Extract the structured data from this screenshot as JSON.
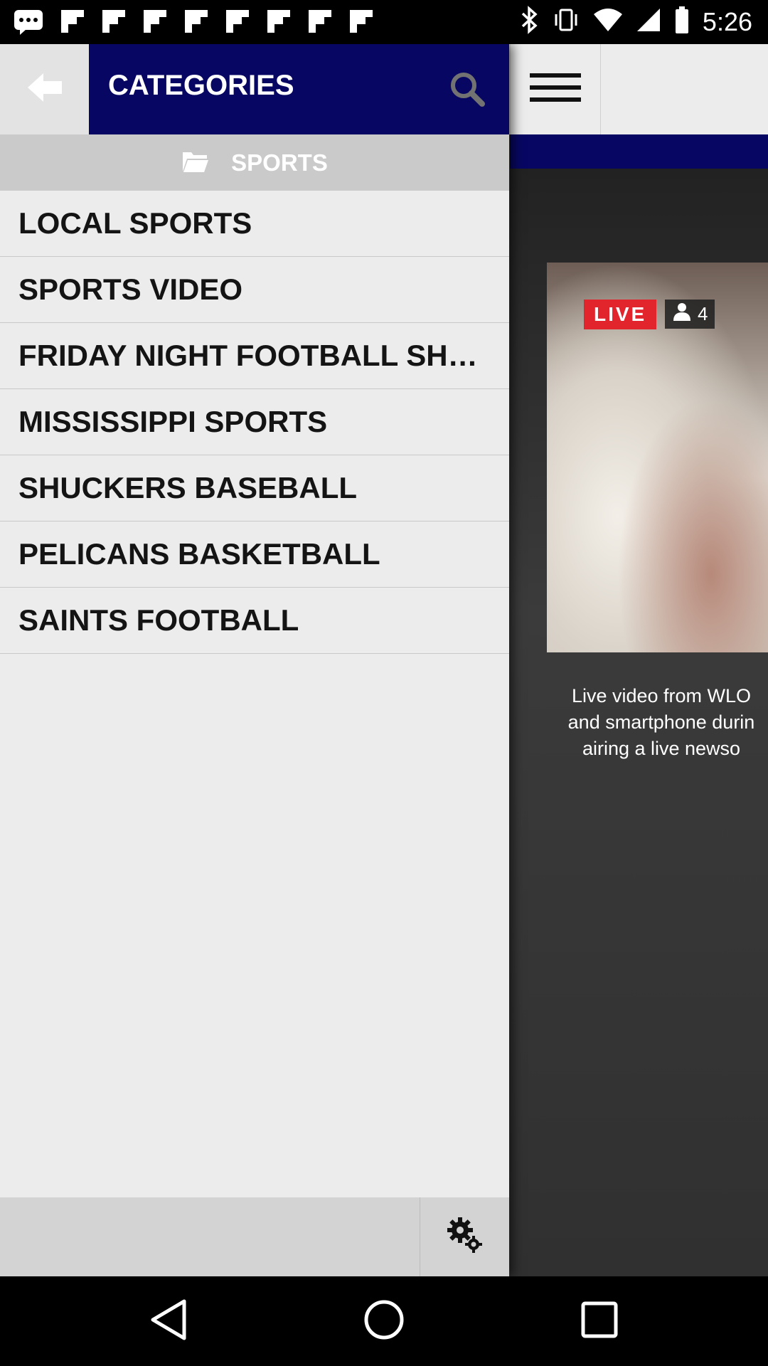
{
  "status_bar": {
    "time": "5:26",
    "icons": [
      "messages-icon",
      "flipboard-icon",
      "bluetooth-icon",
      "vibrate-icon",
      "wifi-icon",
      "signal-icon",
      "battery-icon"
    ]
  },
  "drawer": {
    "title": "CATEGORIES",
    "back_icon": "back-arrow-icon",
    "search_icon": "search-icon",
    "subheader": {
      "icon": "folder-icon",
      "label": "SPORTS"
    },
    "items": [
      {
        "label": "LOCAL SPORTS"
      },
      {
        "label": "SPORTS VIDEO"
      },
      {
        "label": "FRIDAY NIGHT FOOTBALL SHOWCASE"
      },
      {
        "label": "MISSISSIPPI SPORTS"
      },
      {
        "label": "SHUCKERS BASEBALL"
      },
      {
        "label": "PELICANS BASKETBALL"
      },
      {
        "label": "SAINTS FOOTBALL"
      }
    ],
    "settings_icon": "settings-gears-icon"
  },
  "background_page": {
    "menu_icon": "hamburger-menu-icon",
    "video": {
      "live_label": "LIVE",
      "viewer_count": "4",
      "description_lines": [
        "Live video from WLO",
        "and smartphone durin",
        "airing a live newso"
      ]
    }
  },
  "nav_bar": {
    "back": "back-triangle-icon",
    "home": "home-circle-icon",
    "recents": "recents-square-icon"
  },
  "colors": {
    "navy": "#070763",
    "drawer_bg": "#ececec",
    "live_red": "#e2242d"
  }
}
